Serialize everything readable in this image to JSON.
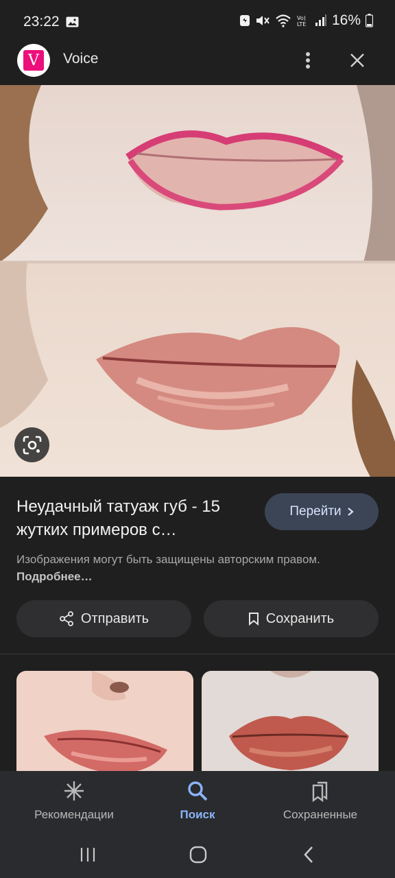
{
  "status_bar": {
    "time": "23:22",
    "battery": "16%",
    "icons": [
      "gallery-icon",
      "sync-icon",
      "mute-icon",
      "wifi-icon",
      "volte-icon",
      "signal-icon",
      "battery-icon"
    ]
  },
  "header": {
    "site_name": "Voice",
    "logo_letter": "V",
    "logo_color": "#ec0f7b",
    "icons": [
      "more-vert-icon",
      "close-icon"
    ]
  },
  "result": {
    "title": "Неудачный татуаж губ - 15 жутких примеров с…",
    "visit_label": "Перейти",
    "copyright_text": "Изображения могут быть защищены авторским правом.",
    "copyright_link": "Подробнее…"
  },
  "actions": {
    "share_label": "Отправить",
    "save_label": "Сохранить"
  },
  "bottom_nav": {
    "items": [
      {
        "label": "Рекомендации",
        "icon": "sparkle-icon",
        "active": false
      },
      {
        "label": "Поиск",
        "icon": "search-icon",
        "active": true
      },
      {
        "label": "Сохраненные",
        "icon": "bookmarks-icon",
        "active": false
      }
    ],
    "accent": "#8ab4f8"
  },
  "system_nav": {
    "icons": [
      "recents-icon",
      "home-icon",
      "back-icon"
    ]
  }
}
